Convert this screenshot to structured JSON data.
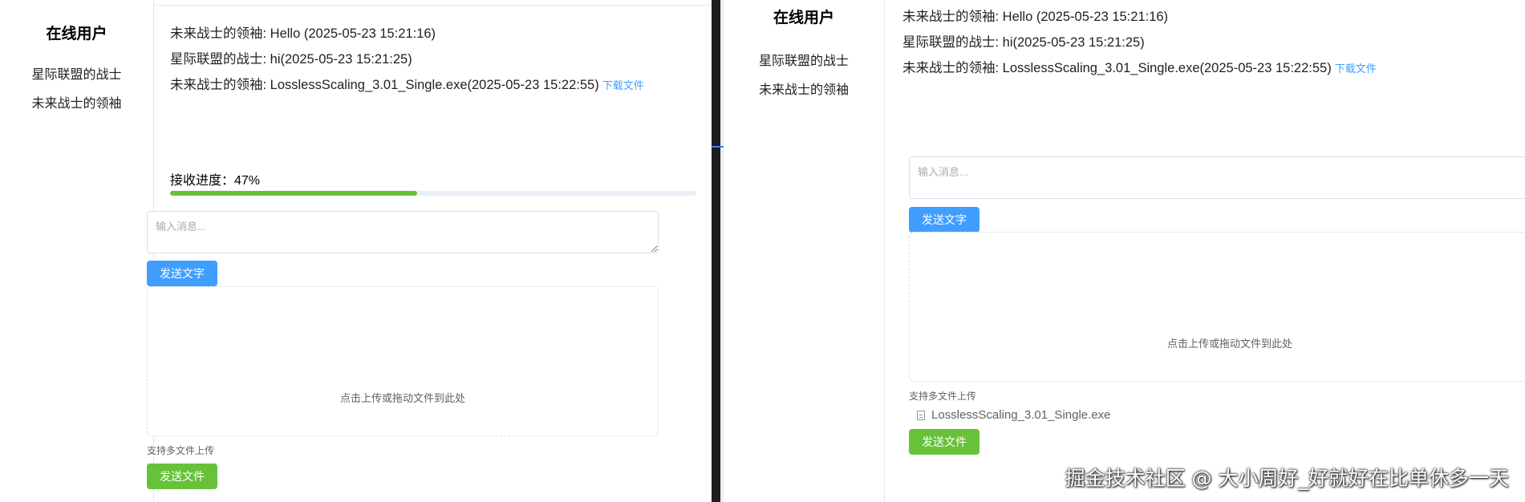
{
  "sidebar": {
    "title": "在线用户"
  },
  "left_window": {
    "users": [
      "星际联盟的战士",
      "未来战士的领袖"
    ],
    "messages": [
      {
        "text": "未来战士的领袖: Hello (2025-05-23 15:21:16)",
        "link": ""
      },
      {
        "text": "星际联盟的战士: hi(2025-05-23 15:21:25)",
        "link": ""
      },
      {
        "text": "未来战士的领袖: LosslessScaling_3.01_Single.exe(2025-05-23 15:22:55)",
        "link": "下载文件"
      }
    ],
    "progress": {
      "label": "接收进度：47%",
      "percent": 47
    },
    "input_placeholder": "输入消息...",
    "send_text_label": "发送文字",
    "dropzone_text": "点击上传或拖动文件到此处",
    "upload_tip": "支持多文件上传",
    "send_file_label": "发送文件"
  },
  "right_window": {
    "users": [
      "星际联盟的战士",
      "未来战士的领袖"
    ],
    "messages": [
      {
        "text": "未来战士的领袖: Hello (2025-05-23 15:21:16)",
        "link": ""
      },
      {
        "text": "星际联盟的战士: hi(2025-05-23 15:21:25)",
        "link": ""
      },
      {
        "text": "未来战士的领袖: LosslessScaling_3.01_Single.exe(2025-05-23 15:22:55)",
        "link": "下载文件"
      }
    ],
    "input_placeholder": "输入消息...",
    "send_text_label": "发送文字",
    "dropzone_text": "点击上传或拖动文件到此处",
    "upload_tip": "支持多文件上传",
    "selected_file": "LosslessScaling_3.01_Single.exe",
    "send_file_label": "发送文件"
  },
  "watermark": "掘金技术社区 @ 大小周好_好就好在比单休多一天",
  "colors": {
    "primary": "#409eff",
    "success": "#67c23a",
    "border": "#dcdfe6"
  }
}
